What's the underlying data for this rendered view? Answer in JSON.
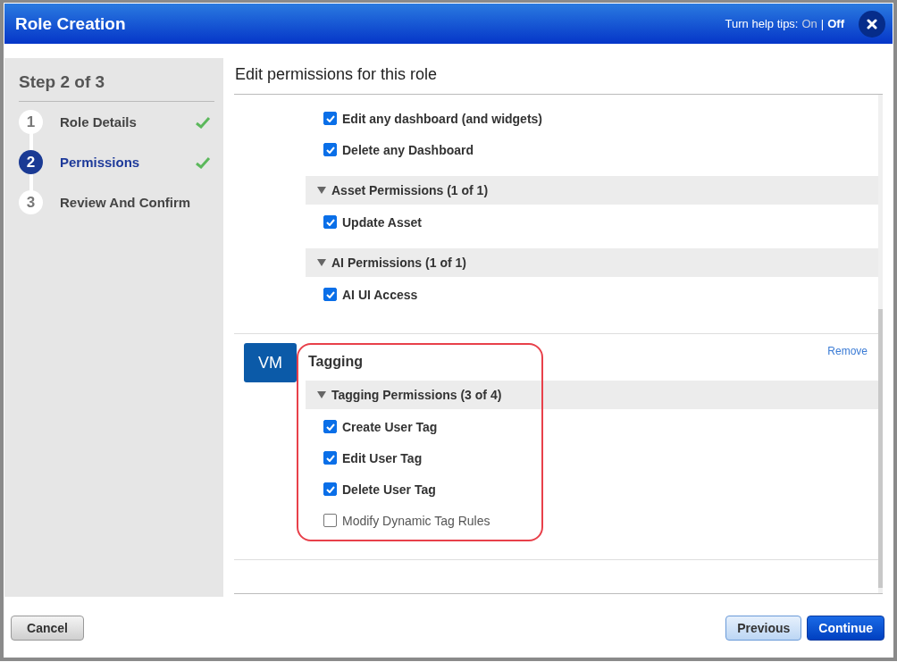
{
  "window": {
    "title": "Role Creation"
  },
  "help_tips": {
    "label": "Turn help tips:",
    "separator": "|",
    "options": [
      {
        "label": "On",
        "selected": false
      },
      {
        "label": "Off",
        "selected": true
      }
    ]
  },
  "sidebar": {
    "title": "Step 2 of 3",
    "steps": [
      {
        "number": "1",
        "label": "Role Details",
        "selected": false,
        "done": true
      },
      {
        "number": "2",
        "label": "Permissions",
        "selected": true,
        "done": true
      },
      {
        "number": "3",
        "label": "Review And Confirm",
        "selected": false,
        "done": false
      }
    ]
  },
  "main": {
    "title": "Edit permissions for this role",
    "modules": [
      {
        "groups": [
          {
            "items": [
              {
                "label": "Edit any dashboard (and widgets)",
                "checked": true
              },
              {
                "label": "Delete any Dashboard",
                "checked": true
              }
            ]
          },
          {
            "title": "Asset Permissions (1 of 1)",
            "expanded": true,
            "items": [
              {
                "label": "Update Asset",
                "checked": true
              }
            ]
          },
          {
            "title": "AI Permissions (1 of 1)",
            "expanded": true,
            "items": [
              {
                "label": "AI UI Access",
                "checked": true
              }
            ]
          }
        ]
      },
      {
        "badge": "VM",
        "title": "Tagging",
        "remove": "Remove",
        "highlighted": true,
        "groups": [
          {
            "title": "Tagging Permissions (3 of 4)",
            "expanded": true,
            "items": [
              {
                "label": "Create User Tag",
                "checked": true
              },
              {
                "label": "Edit User Tag",
                "checked": true
              },
              {
                "label": "Delete User Tag",
                "checked": true
              },
              {
                "label": "Modify Dynamic Tag Rules",
                "checked": false
              }
            ]
          }
        ]
      }
    ]
  },
  "buttons": {
    "cancel": "Cancel",
    "previous": "Previous",
    "continue": "Continue"
  }
}
